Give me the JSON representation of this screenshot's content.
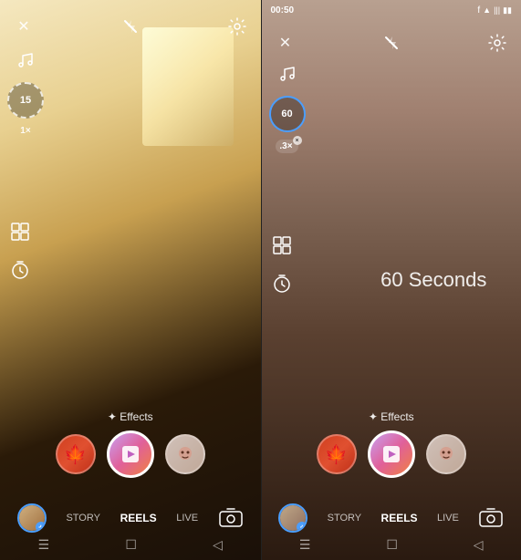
{
  "panels": {
    "left": {
      "timer_value": "15",
      "speed_value": "1×",
      "effects_label": "✦ Effects",
      "nav_items": [
        "STORY",
        "REELS",
        "LIVE"
      ],
      "active_nav": "REELS",
      "seconds_text": ""
    },
    "right": {
      "status_time": "00:50",
      "timer_value": "60",
      "speed_value": ".3×",
      "effects_label": "✦ Effects",
      "seconds_text": "60 Seconds",
      "nav_items": [
        "STORY",
        "REELS",
        "LIVE"
      ],
      "active_nav": "REELS"
    }
  },
  "icons": {
    "close": "✕",
    "flash_off": "⚡",
    "settings": "⚙",
    "music": "♪",
    "grid": "⊞",
    "timer": "⏱",
    "camera_flip": "🔄",
    "plus": "+",
    "sparkle": "✦"
  },
  "colors": {
    "accent_blue": "#4a9eff",
    "white": "#ffffff",
    "nav_active": "#ffffff",
    "nav_inactive": "rgba(255,255,255,0.6)"
  }
}
